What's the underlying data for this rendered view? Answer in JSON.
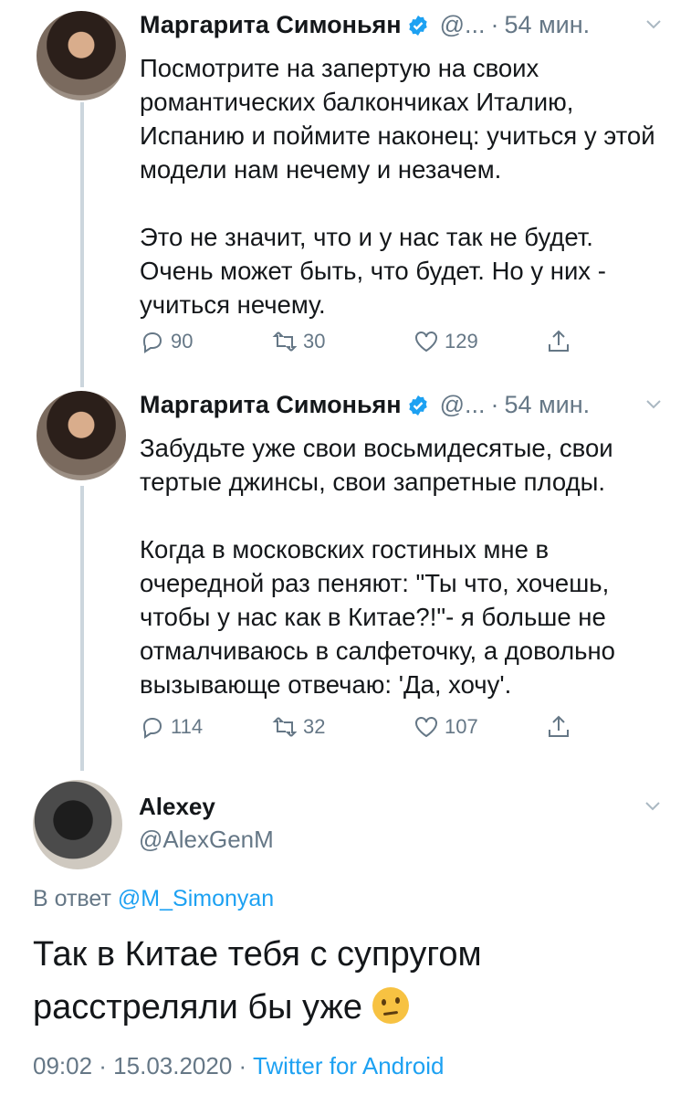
{
  "tweets": [
    {
      "name": "Маргарита Симоньян",
      "handle": "@...",
      "dot": "·",
      "time": "54 мин.",
      "paragraphs": [
        "Посмотрите на запертую на своих романтических балкончиках Италию, Испанию и поймите наконец: учиться у этой модели нам нечему и незачем.",
        "Это не значит, что и у нас так не будет. Очень может быть, что будет. Но у них - учиться нечему."
      ],
      "replies": "90",
      "retweets": "30",
      "likes": "129"
    },
    {
      "name": "Маргарита Симоньян",
      "handle": "@...",
      "dot": "·",
      "time": "54 мин.",
      "paragraphs": [
        "Забудьте уже свои восьмидесятые, свои тертые джинсы, свои запретные плоды.",
        "Когда в московских гостиных мне в очередной раз пеняют: \"Ты что, хочешь, чтобы у нас как в Китае?!\"- я больше не отмалчиваюсь в салфеточку, а довольно вызывающе отвечаю: 'Да, хочу'."
      ],
      "replies": "114",
      "retweets": "32",
      "likes": "107"
    }
  ],
  "reply": {
    "name": "Alexey",
    "handle": "@AlexGenM",
    "reply_prefix": "В ответ",
    "reply_to": "@M_Simonyan",
    "text": "Так в Китае тебя с супругом расстреляли бы уже",
    "emoji": "thinking-face-emoji",
    "time": "09:02 · 15.03.2020 ·",
    "source": "Twitter for Android"
  },
  "colors": {
    "muted": "#657786",
    "link": "#1da1f2",
    "verified": "#1da1f2",
    "thread_line": "#ccd6dd"
  }
}
